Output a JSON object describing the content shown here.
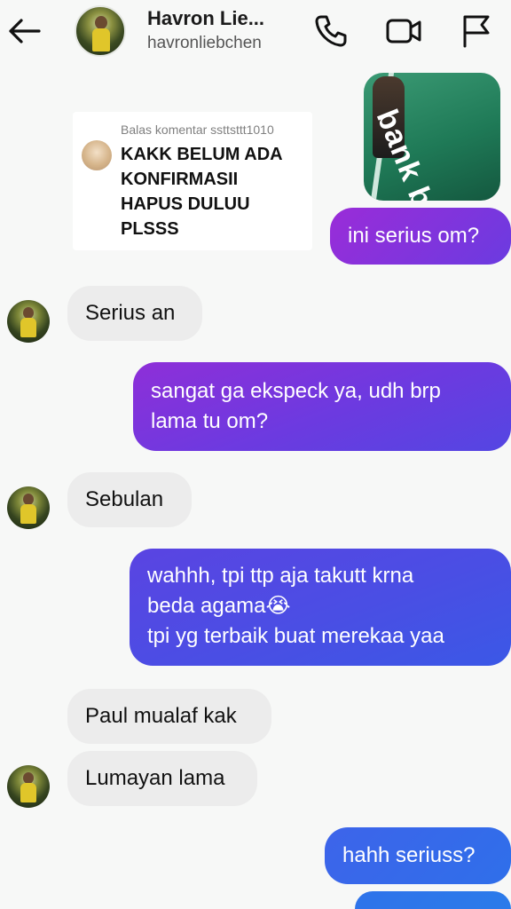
{
  "header": {
    "name": "Havron Lie...",
    "username": "havronliebchen",
    "icons": [
      "back-arrow-icon",
      "phone-icon",
      "video-icon",
      "flag-icon"
    ]
  },
  "reply": {
    "label": "Balas komentar ssttsttt1010",
    "lines": [
      "KAKK BELUM ADA",
      "KONFIRMASII",
      "HAPUS DULUU",
      "PLSSS"
    ]
  },
  "sticker": {
    "text": "bank bjb"
  },
  "messages": [
    {
      "from": "me",
      "lines": [
        "ini serius om?"
      ]
    },
    {
      "from": "them",
      "lines": [
        "Serius an"
      ]
    },
    {
      "from": "me",
      "lines": [
        "sangat ga ekspeck ya, udh brp",
        "lama tu om?"
      ]
    },
    {
      "from": "them",
      "lines": [
        "Sebulan"
      ]
    },
    {
      "from": "me",
      "lines": [
        "wahhh, tpi ttp aja takutt krna",
        "beda agama😭",
        "tpi yg terbaik buat merekaa yaa"
      ]
    },
    {
      "from": "them",
      "lines": [
        "Paul mualaf kak"
      ]
    },
    {
      "from": "them",
      "lines": [
        "Lumayan lama"
      ]
    },
    {
      "from": "me",
      "lines": [
        "hahh seriuss?"
      ]
    }
  ],
  "colors": {
    "background": "#f7f8f7",
    "outgoing_top": "#8a2bd6",
    "outgoing_bottom": "#3b55e6",
    "incoming": "#ececec"
  }
}
